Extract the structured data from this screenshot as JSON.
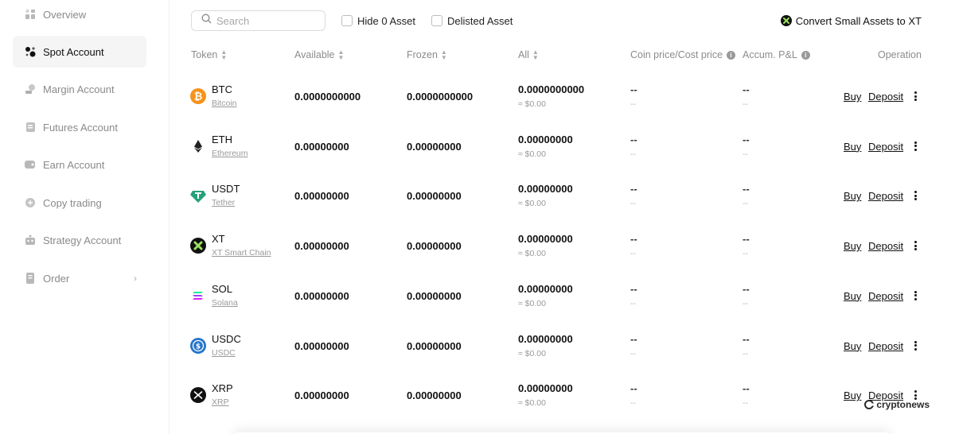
{
  "sidebar": {
    "items": [
      {
        "label": "Overview",
        "icon": "overview-icon"
      },
      {
        "label": "Spot Account",
        "icon": "spot-icon",
        "active": true
      },
      {
        "label": "Margin Account",
        "icon": "margin-icon"
      },
      {
        "label": "Futures Account",
        "icon": "futures-icon"
      },
      {
        "label": "Earn Account",
        "icon": "earn-icon"
      },
      {
        "label": "Copy trading",
        "icon": "copy-trading-icon"
      },
      {
        "label": "Strategy Account",
        "icon": "strategy-icon"
      },
      {
        "label": "Order",
        "icon": "order-icon",
        "has_submenu": true
      }
    ]
  },
  "toolbar": {
    "search_placeholder": "Search",
    "hide_zero_label": "Hide 0 Asset",
    "delisted_label": "Delisted Asset",
    "convert_label": "Convert Small Assets to XT"
  },
  "table": {
    "headers": {
      "token": "Token",
      "available": "Available",
      "frozen": "Frozen",
      "all": "All",
      "price": "Coin price/Cost price",
      "pnl": "Accum. P&L",
      "operation": "Operation"
    },
    "rows": [
      {
        "symbol": "BTC",
        "name": "Bitcoin",
        "available": "0.0000000000",
        "frozen": "0.0000000000",
        "all": "0.0000000000",
        "all_usd": "≈ $0.00",
        "price": "--",
        "price_sub": "--",
        "pnl": "--",
        "pnl_sub": "--",
        "buy": "Buy",
        "deposit": "Deposit",
        "color": "#f7931a"
      },
      {
        "symbol": "ETH",
        "name": "Ethereum",
        "available": "0.00000000",
        "frozen": "0.00000000",
        "all": "0.00000000",
        "all_usd": "≈ $0.00",
        "price": "--",
        "price_sub": "--",
        "pnl": "--",
        "pnl_sub": "--",
        "buy": "Buy",
        "deposit": "Deposit",
        "color": "#222222"
      },
      {
        "symbol": "USDT",
        "name": "Tether",
        "available": "0.00000000",
        "frozen": "0.00000000",
        "all": "0.00000000",
        "all_usd": "≈ $0.00",
        "price": "--",
        "price_sub": "--",
        "pnl": "--",
        "pnl_sub": "--",
        "buy": "Buy",
        "deposit": "Deposit",
        "color": "#26a17b"
      },
      {
        "symbol": "XT",
        "name": "XT Smart Chain",
        "available": "0.00000000",
        "frozen": "0.00000000",
        "all": "0.00000000",
        "all_usd": "≈ $0.00",
        "price": "--",
        "price_sub": "--",
        "pnl": "--",
        "pnl_sub": "--",
        "buy": "Buy",
        "deposit": "Deposit",
        "color": "#111111"
      },
      {
        "symbol": "SOL",
        "name": "Solana",
        "available": "0.00000000",
        "frozen": "0.00000000",
        "all": "0.00000000",
        "all_usd": "≈ $0.00",
        "price": "--",
        "price_sub": "--",
        "pnl": "--",
        "pnl_sub": "--",
        "buy": "Buy",
        "deposit": "Deposit",
        "color": "#9945ff"
      },
      {
        "symbol": "USDC",
        "name": "USDC",
        "available": "0.00000000",
        "frozen": "0.00000000",
        "all": "0.00000000",
        "all_usd": "≈ $0.00",
        "price": "--",
        "price_sub": "--",
        "pnl": "--",
        "pnl_sub": "--",
        "buy": "Buy",
        "deposit": "Deposit",
        "color": "#2775ca"
      },
      {
        "symbol": "XRP",
        "name": "XRP",
        "available": "0.00000000",
        "frozen": "0.00000000",
        "all": "0.00000000",
        "all_usd": "≈ $0.00",
        "price": "--",
        "price_sub": "--",
        "pnl": "--",
        "pnl_sub": "--",
        "buy": "Buy",
        "deposit": "Deposit",
        "color": "#111111"
      }
    ]
  },
  "watermark": "cryptonews"
}
